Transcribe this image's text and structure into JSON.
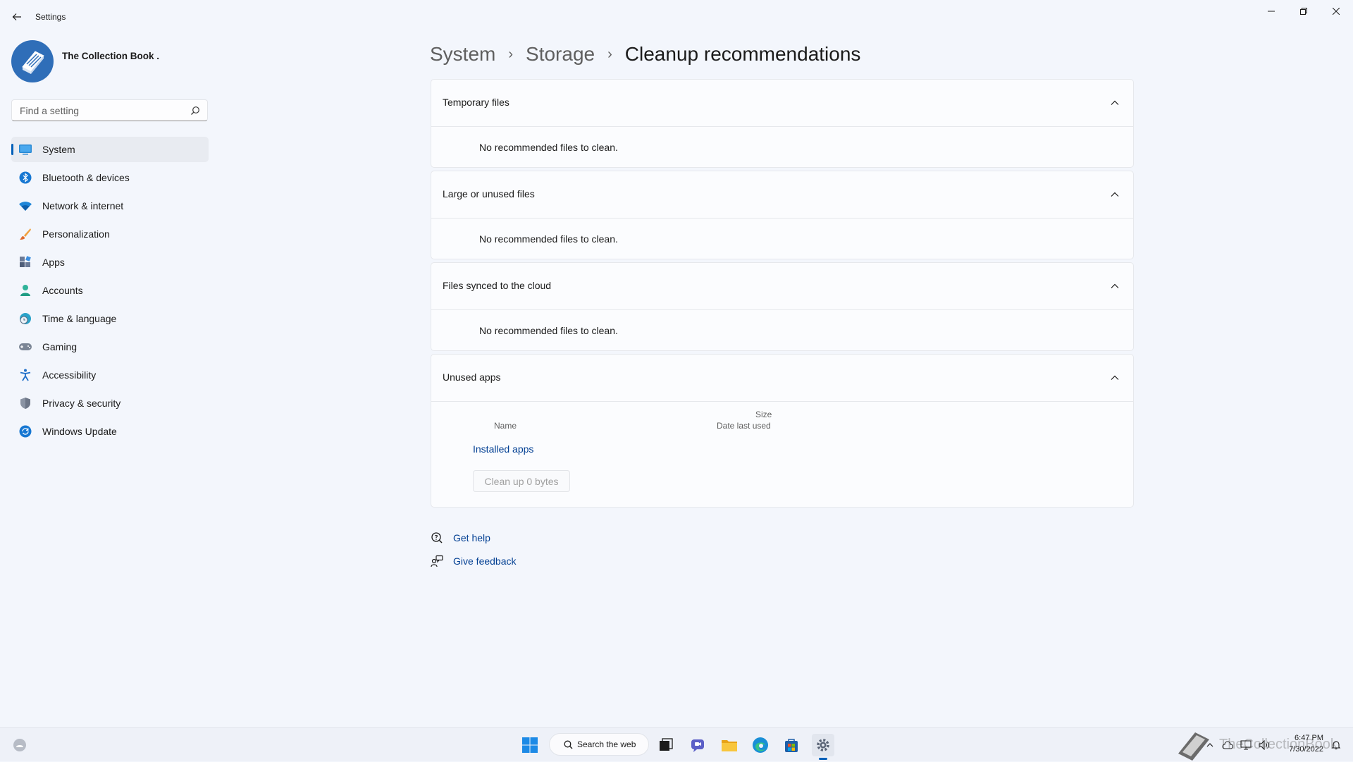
{
  "window": {
    "title": "Settings"
  },
  "profile": {
    "name": "The Collection Book ."
  },
  "search": {
    "placeholder": "Find a setting"
  },
  "nav": {
    "items": [
      {
        "label": "System",
        "icon": "system-icon",
        "active": true
      },
      {
        "label": "Bluetooth & devices",
        "icon": "bluetooth-icon"
      },
      {
        "label": "Network & internet",
        "icon": "wifi-icon"
      },
      {
        "label": "Personalization",
        "icon": "brush-icon"
      },
      {
        "label": "Apps",
        "icon": "apps-icon"
      },
      {
        "label": "Accounts",
        "icon": "person-icon"
      },
      {
        "label": "Time & language",
        "icon": "globe-clock-icon"
      },
      {
        "label": "Gaming",
        "icon": "gamepad-icon"
      },
      {
        "label": "Accessibility",
        "icon": "accessibility-icon"
      },
      {
        "label": "Privacy & security",
        "icon": "shield-icon"
      },
      {
        "label": "Windows Update",
        "icon": "update-icon"
      }
    ]
  },
  "breadcrumb": {
    "level1": "System",
    "level2": "Storage",
    "current": "Cleanup recommendations"
  },
  "sections": {
    "temporary": {
      "title": "Temporary files",
      "message": "No recommended files to clean."
    },
    "large": {
      "title": "Large or unused files",
      "message": "No recommended files to clean."
    },
    "cloud": {
      "title": "Files synced to the cloud",
      "message": "No recommended files to clean."
    },
    "unused_apps": {
      "title": "Unused apps",
      "col_size": "Size",
      "col_date": "Date last used",
      "col_name": "Name",
      "installed_apps_link": "Installed apps",
      "cleanup_button": "Clean up 0 bytes"
    }
  },
  "help": {
    "get_help": "Get help",
    "give_feedback": "Give feedback"
  },
  "taskbar": {
    "search_label": "Search the web",
    "time": "6:47 PM",
    "date": "7/30/2022",
    "watermark": "TheCollectionBook"
  },
  "colors": {
    "accent": "#005fb8",
    "link": "#003e92",
    "background": "#f3f6fc"
  }
}
